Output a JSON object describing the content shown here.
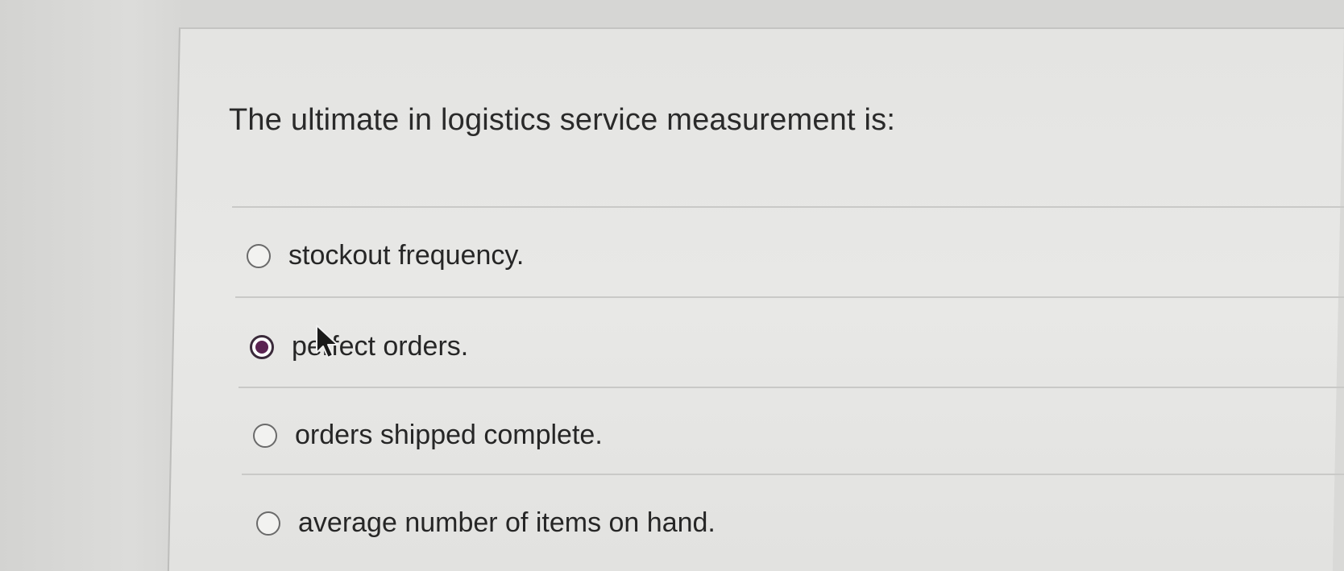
{
  "question": {
    "text": "The ultimate in logistics service measurement is:"
  },
  "options": [
    {
      "label": "stockout frequency.",
      "selected": false
    },
    {
      "label": "perfect orders.",
      "selected": true
    },
    {
      "label": "orders shipped complete.",
      "selected": false
    },
    {
      "label": "average number of items on hand.",
      "selected": false
    }
  ],
  "colors": {
    "selected_radio": "#5b2452",
    "text": "#262626",
    "panel_background": "#e6e6e4"
  },
  "icons": {
    "cursor": "mouse-pointer-icon"
  }
}
